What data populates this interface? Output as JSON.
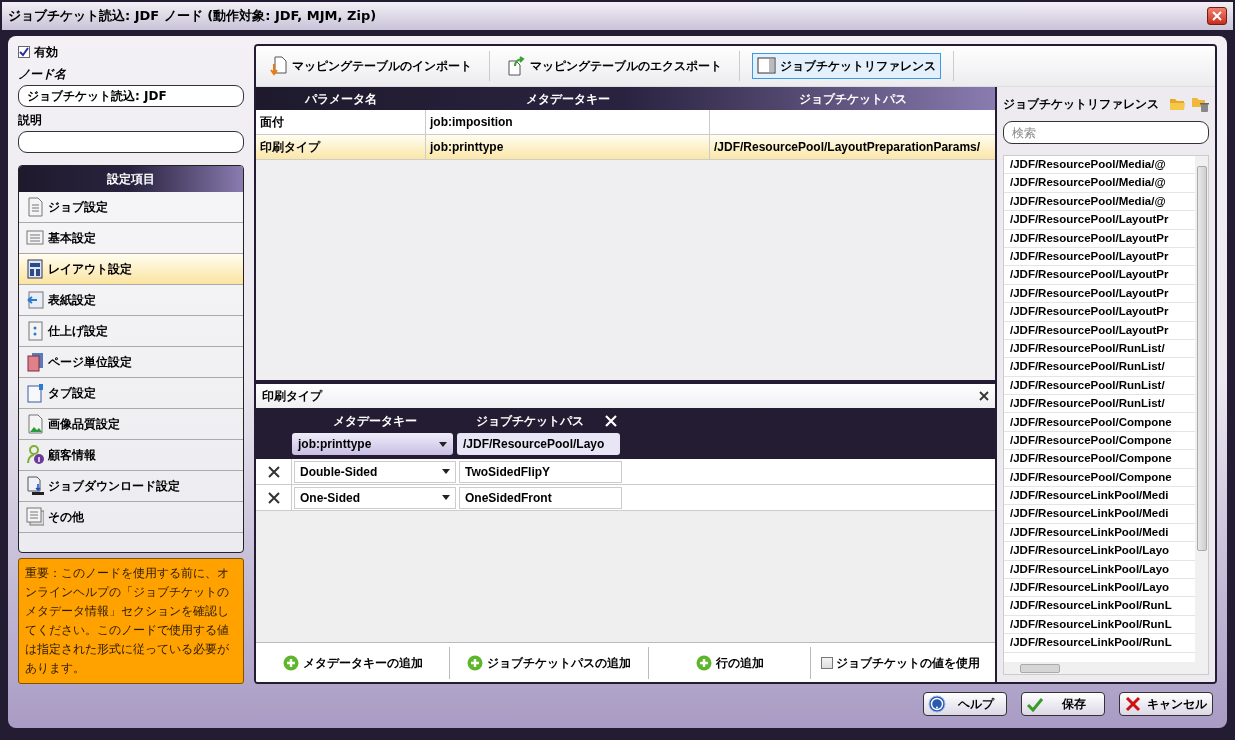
{
  "window": {
    "title": "ジョブチケット読込: JDF ノード (動作対象: JDF, MJM, Zip)"
  },
  "general": {
    "enabled": {
      "label": "有効",
      "checked": true
    },
    "node_name": {
      "label": "ノード名",
      "value": "ジョブチケット読込: JDF"
    },
    "description": {
      "label": "説明"
    }
  },
  "settings": {
    "title": "設定項目",
    "items": [
      {
        "label": "ジョブ設定",
        "selected": false
      },
      {
        "label": "基本設定",
        "selected": false
      },
      {
        "label": "レイアウト設定",
        "selected": true
      },
      {
        "label": "表紙設定",
        "selected": false
      },
      {
        "label": "仕上げ設定",
        "selected": false
      },
      {
        "label": "ページ単位設定",
        "selected": false
      },
      {
        "label": "タブ設定",
        "selected": false
      },
      {
        "label": "画像品質設定",
        "selected": false
      },
      {
        "label": "顧客情報",
        "selected": false
      },
      {
        "label": "ジョブダウンロード設定",
        "selected": false
      },
      {
        "label": "その他",
        "selected": false
      }
    ]
  },
  "notice": "重要：このノードを使用する前に、オンラインヘルプの「ジョブチケットのメタデータ情報」セクションを確認してください。このノードで使用する値は指定された形式に従っている必要があります。",
  "toolbar": [
    {
      "label": "マッピングテーブルのインポート",
      "selected": false
    },
    {
      "label": "マッピングテーブルのエクスポート",
      "selected": false
    },
    {
      "label": "ジョブチケットリファレンス",
      "selected": true
    }
  ],
  "mapping_table": {
    "columns": [
      "パラメータ名",
      "メタデータキー",
      "ジョブチケットパス"
    ],
    "rows": [
      {
        "cells": [
          "面付",
          "job:imposition",
          ""
        ],
        "selected": false
      },
      {
        "cells": [
          "印刷タイプ",
          "job:printtype",
          "/JDF/ResourcePool/LayoutPreparationParams/"
        ],
        "selected": true
      }
    ]
  },
  "detail": {
    "title": "印刷タイプ",
    "columns": [
      "メタデータキー",
      "ジョブチケットパス"
    ],
    "key_select": "job:printtype",
    "path_field": "/JDF/ResourcePool/Layo",
    "rows": [
      {
        "key": "Double-Sided",
        "path": "TwoSidedFlipY"
      },
      {
        "key": "One-Sided",
        "path": "OneSidedFront"
      }
    ],
    "actions": [
      "メタデータキーの追加",
      "ジョブチケットパスの追加",
      "行の追加"
    ],
    "use_ticket_values": {
      "label": "ジョブチケットの値を使用",
      "checked": false
    }
  },
  "reference": {
    "title": "ジョブチケットリファレンス",
    "search": {
      "placeholder": "検索"
    },
    "items": [
      "/JDF/ResourcePool/Media/@",
      "/JDF/ResourcePool/Media/@",
      "/JDF/ResourcePool/Media/@",
      "/JDF/ResourcePool/LayoutPr",
      "/JDF/ResourcePool/LayoutPr",
      "/JDF/ResourcePool/LayoutPr",
      "/JDF/ResourcePool/LayoutPr",
      "/JDF/ResourcePool/LayoutPr",
      "/JDF/ResourcePool/LayoutPr",
      "/JDF/ResourcePool/LayoutPr",
      "/JDF/ResourcePool/RunList/",
      "/JDF/ResourcePool/RunList/",
      "/JDF/ResourcePool/RunList/",
      "/JDF/ResourcePool/RunList/",
      "/JDF/ResourcePool/Compone",
      "/JDF/ResourcePool/Compone",
      "/JDF/ResourcePool/Compone",
      "/JDF/ResourcePool/Compone",
      "/JDF/ResourceLinkPool/Medi",
      "/JDF/ResourceLinkPool/Medi",
      "/JDF/ResourceLinkPool/Medi",
      "/JDF/ResourceLinkPool/Layo",
      "/JDF/ResourceLinkPool/Layo",
      "/JDF/ResourceLinkPool/Layo",
      "/JDF/ResourceLinkPool/RunL",
      "/JDF/ResourceLinkPool/RunL",
      "/JDF/ResourceLinkPool/RunL"
    ]
  },
  "buttons": [
    {
      "label": "ヘルプ",
      "kind": "help"
    },
    {
      "label": "保存",
      "kind": "save"
    },
    {
      "label": "キャンセル",
      "kind": "cancel"
    }
  ]
}
